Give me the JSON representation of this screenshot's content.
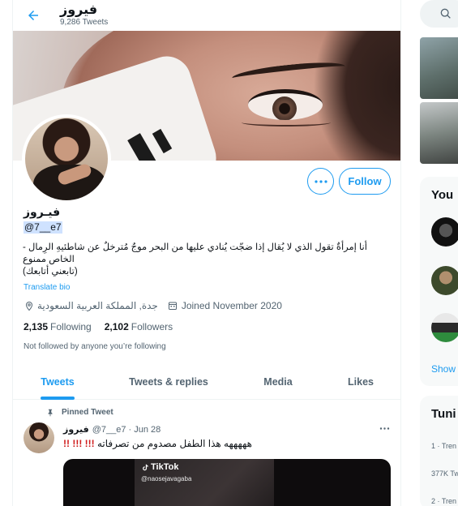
{
  "header": {
    "display_name": "فيروز",
    "tweet_count": "9,286 Tweets"
  },
  "profile": {
    "display_name": "فيـروز",
    "handle": "@7__e7",
    "bio_lines": [
      "أنا إمرأةٌ تقول الذي لا يُقال إذا ضجّت يُنادي عليها من البحر موجٌ مُترخلٌ عن شاطئيهِ الرِمال -",
      "الخاص ممنوع",
      "(تابعني أتابعك)"
    ],
    "translate_label": "Translate bio",
    "location": "جدة, المملكة العربية السعودية",
    "joined": "Joined November 2020",
    "following_count": "2,135",
    "following_label": "Following",
    "followers_count": "2,102",
    "followers_label": "Followers",
    "not_followed_text": "Not followed by anyone you’re following",
    "follow_label": "Follow",
    "more_label": "•••"
  },
  "tabs": [
    {
      "label": "Tweets",
      "active": true
    },
    {
      "label": "Tweets & replies",
      "active": false
    },
    {
      "label": "Media",
      "active": false
    },
    {
      "label": "Likes",
      "active": false
    }
  ],
  "pinned_tweet": {
    "pinned_label": "Pinned Tweet",
    "author_name": "فيروز",
    "author_handle": "@7__e7",
    "date": "Jun 28",
    "text": "هههههه هذا الطفل مصدوم من تصرفاته",
    "exclamations": "!!! !!! !!",
    "media_brand": "TikTok",
    "media_user": "@naosejavagaba"
  },
  "sidebar": {
    "who_to_follow_title": "You",
    "show_more": "Show",
    "trends_title": "Tuni",
    "trend_1": "1 · Tren",
    "trend_1_count": "377K Tw",
    "trend_2": "2 · Tren"
  },
  "colors": {
    "accent": "#1d9bf0",
    "text": "#0f1419",
    "muted": "#536471"
  }
}
